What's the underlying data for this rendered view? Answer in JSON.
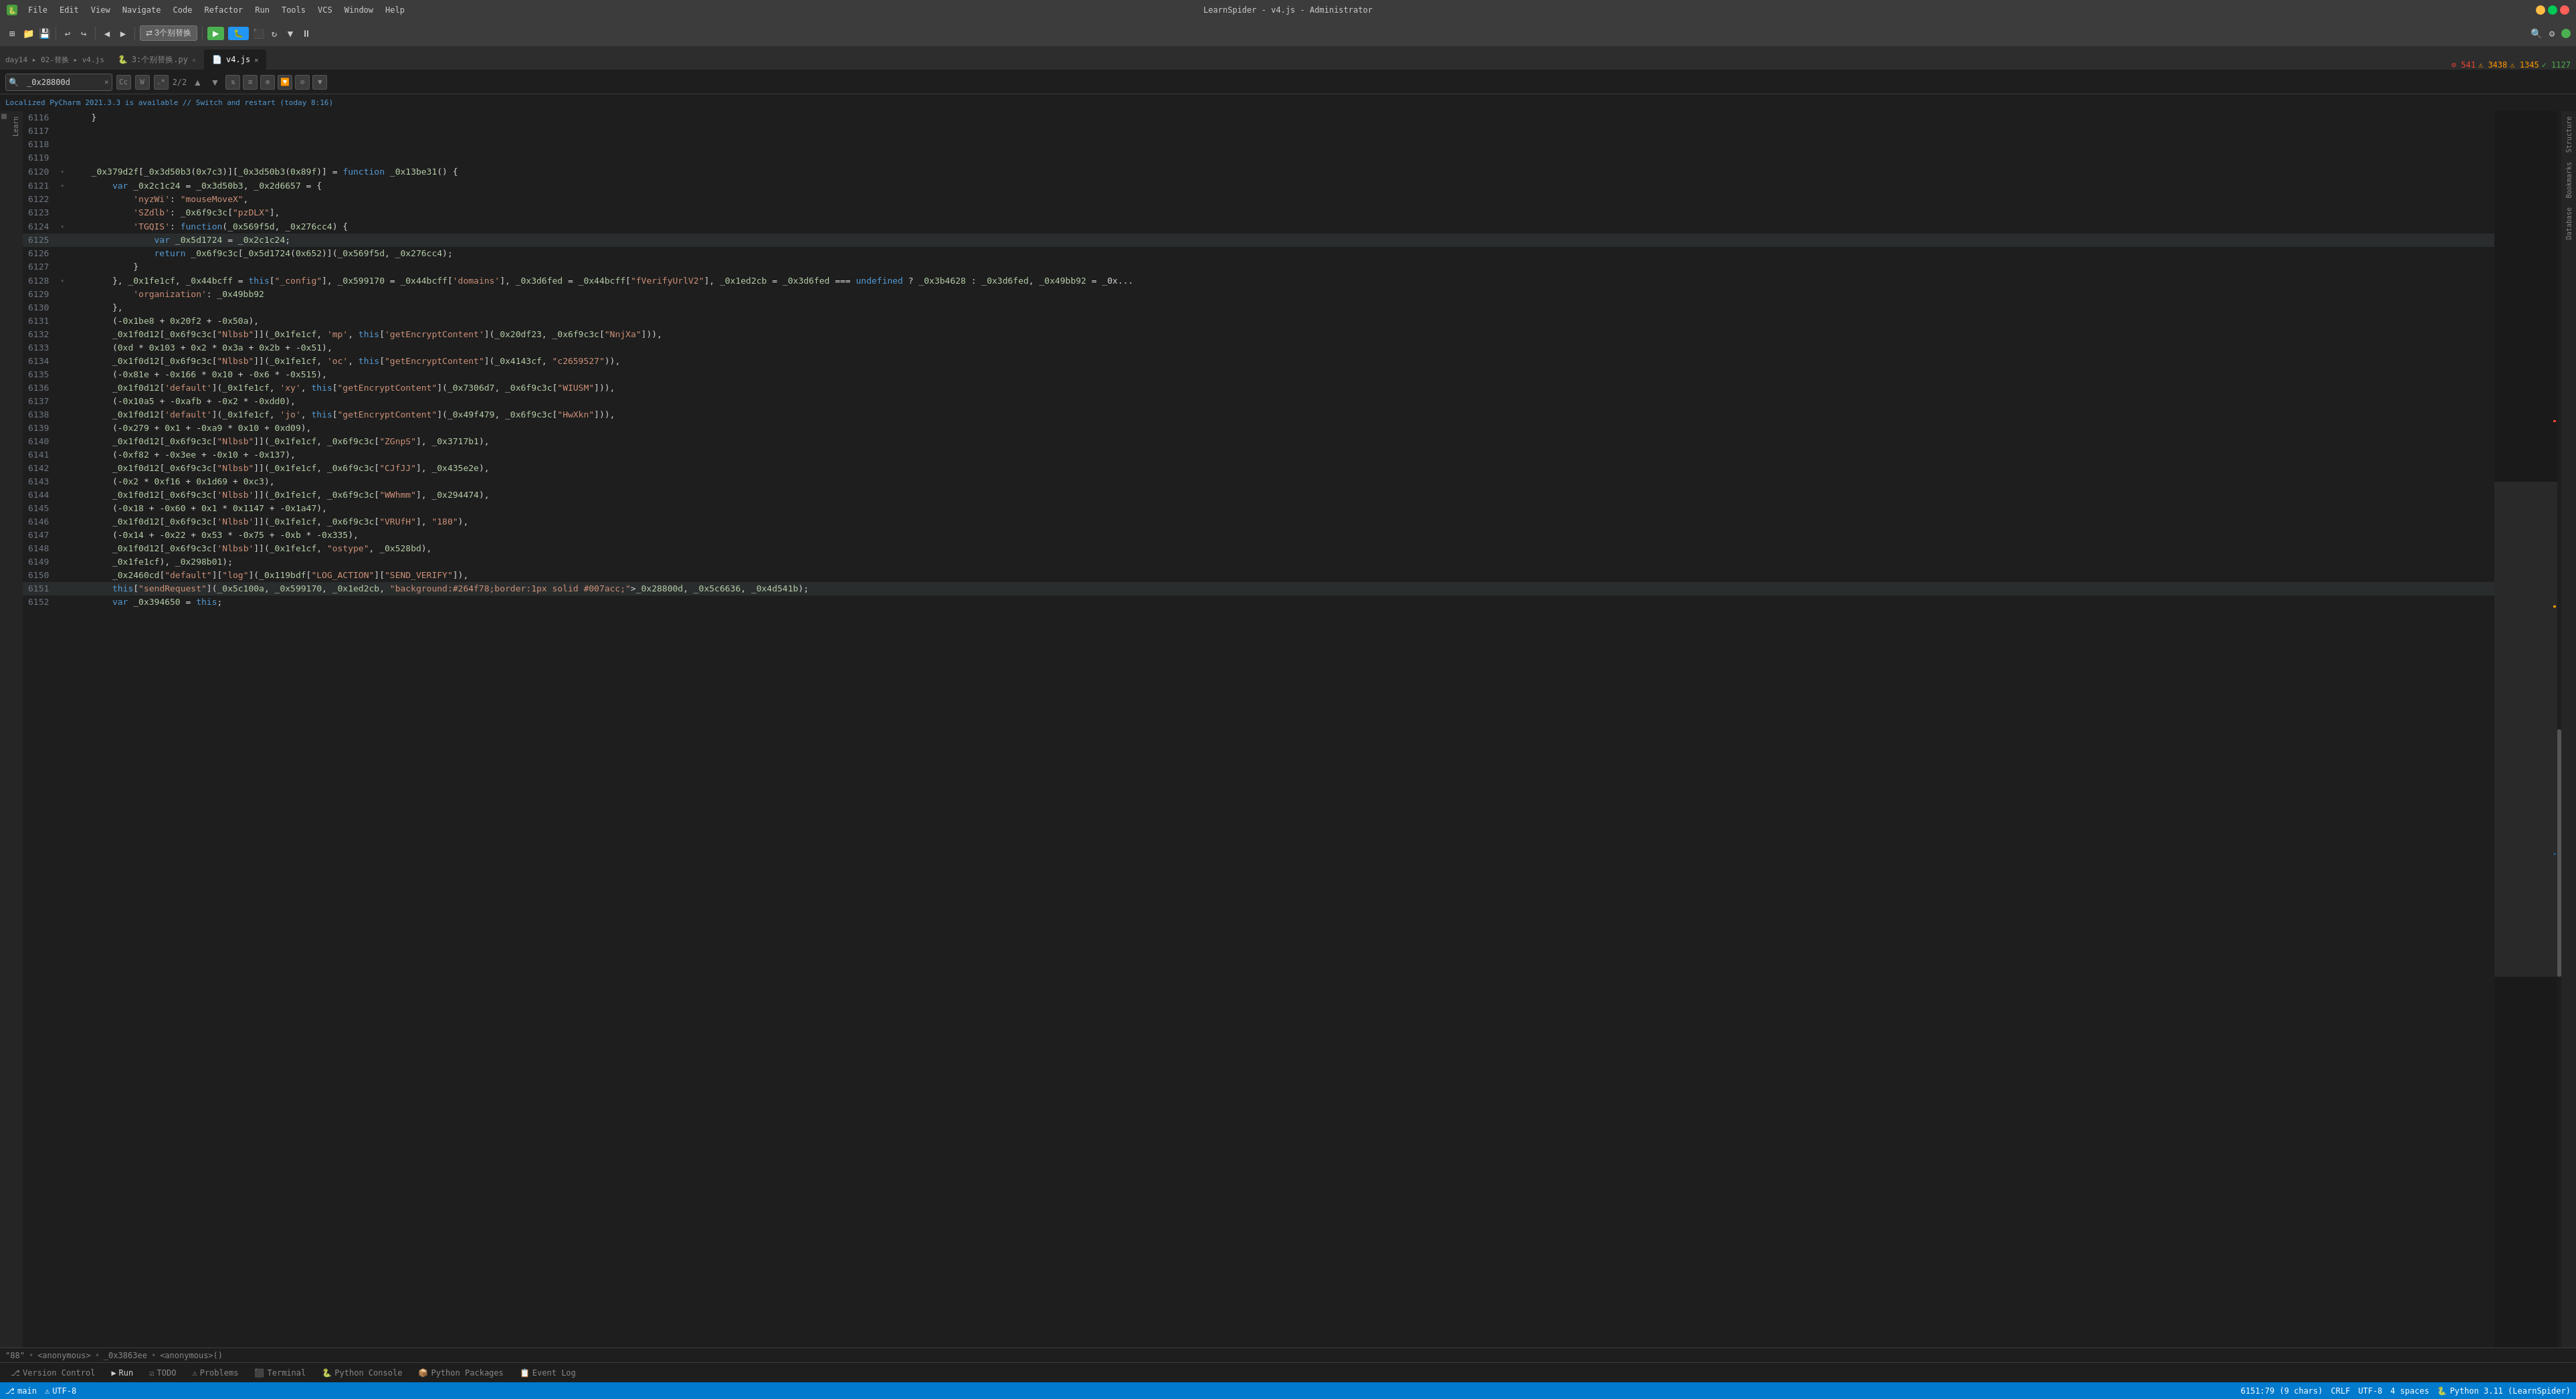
{
  "titleBar": {
    "title": "LearnSpider - v4.js - Administrator",
    "menuItems": [
      "",
      "File",
      "Edit",
      "View",
      "Navigate",
      "Code",
      "Refactor",
      "Run",
      "Tools",
      "VCS",
      "Window",
      "Help"
    ]
  },
  "toolbar": {
    "replaceLabel": "3个别替换",
    "runConfig": "3:个别替换.py"
  },
  "tabs": [
    {
      "label": "3:个别替换.py",
      "active": false,
      "icon": "🐍"
    },
    {
      "label": "v4.js",
      "active": true,
      "icon": "📄"
    }
  ],
  "breadcrumb": {
    "path": "day14 ▸ 02-替换 ▸ v4.js"
  },
  "search": {
    "query": "_0x28800d",
    "count": "2/2",
    "options": [
      "Cc",
      "W",
      ".*"
    ]
  },
  "counters": {
    "errors": "541",
    "warnings": "3438",
    "info": "1345",
    "ok": "1127"
  },
  "codeLines": [
    {
      "num": "6116",
      "indent": "",
      "code": "    }"
    },
    {
      "num": "6117",
      "indent": "",
      "code": ""
    },
    {
      "num": "6118",
      "indent": "",
      "code": ""
    },
    {
      "num": "6119",
      "indent": "",
      "code": ""
    },
    {
      "num": "6120",
      "indent": "",
      "code": "    _0x379d2f[_0x3d50b3(0x7c3)][_0x3d50b3(0x89f)] = function _0x13be31() {"
    },
    {
      "num": "6121",
      "indent": "        ",
      "code": "var _0x2c1c24 = _0x3d50b3, _0x2d6657 = {"
    },
    {
      "num": "6122",
      "indent": "            ",
      "code": "'nyzWi': \"mouseMoveX\","
    },
    {
      "num": "6123",
      "indent": "            ",
      "code": "'SZdlb': _0x6f9c3c[\"pzDLX\"],"
    },
    {
      "num": "6124",
      "indent": "            ",
      "code": "'TGQIS': function(_0x569f5d, _0x276cc4) {"
    },
    {
      "num": "6125",
      "indent": "                ",
      "code": "var _0x5d1724 = _0x2c1c24;"
    },
    {
      "num": "6126",
      "indent": "                ",
      "code": "return _0x6f9c3c[_0x5d1724(0x652)](_0x569f5d, _0x276cc4);"
    },
    {
      "num": "6127",
      "indent": "            ",
      "code": "}"
    },
    {
      "num": "6128",
      "indent": "        ",
      "code": "}, _0x1fe1cf, _0x44bcff = this[\"_config\"], _0x599170 = _0x44bcff['domains'], _0x3d6fed = _0x44bcff[\"fVerifyUrlV2\"], _0x1ed2cb = _0x3d6fed === undefined ? _0x3b4628 : _0x3d6fed, _0x49bb92 = _0x..."
    },
    {
      "num": "6129",
      "indent": "            ",
      "code": "'organization': _0x49bb92"
    },
    {
      "num": "6130",
      "indent": "        ",
      "code": "},"
    },
    {
      "num": "6131",
      "indent": "        ",
      "code": "(-0x1be8 + 0x20f2 + -0x50a),"
    },
    {
      "num": "6132",
      "indent": "        ",
      "code": "_0x1f0d12[_0x6f9c3c[\"Nlbsb\"]](_0x1fe1cf, 'mp', this['getEncryptContent'](_0x20df23, _0x6f9c3c[\"NnjXa\"])),"
    },
    {
      "num": "6133",
      "indent": "        ",
      "code": "(0xd * 0x103 + 0x2 * 0x3a + 0x2b + -0x51),"
    },
    {
      "num": "6134",
      "indent": "        ",
      "code": "_0x1f0d12[_0x6f9c3c[\"Nlbsb\"]](_0x1fe1cf, 'oc', this[\"getEncryptContent\"](_0x4143cf, \"c2659527\")),"
    },
    {
      "num": "6135",
      "indent": "        ",
      "code": "(-0x81e + -0x166 * 0x10 + -0x6 * -0x515),"
    },
    {
      "num": "6136",
      "indent": "        ",
      "code": "_0x1f0d12['default'](_0x1fe1cf, 'xy', this[\"getEncryptContent\"](_0x7306d7, _0x6f9c3c[\"WIUSM\"])),"
    },
    {
      "num": "6137",
      "indent": "        ",
      "code": "(-0x10a5 + -0xafb + -0x2 * -0xdd0),"
    },
    {
      "num": "6138",
      "indent": "        ",
      "code": "_0x1f0d12['default'](_0x1fe1cf, 'jo', this[\"getEncryptContent\"](_0x49f479, _0x6f9c3c[\"HwXkn\"])),"
    },
    {
      "num": "6139",
      "indent": "        ",
      "code": "(-0x279 + 0x1 + -0xa9 * 0x10 + 0xd09),"
    },
    {
      "num": "6140",
      "indent": "        ",
      "code": "_0x1f0d12[_0x6f9c3c[\"Nlbsb\"]](_0x1fe1cf, _0x6f9c3c[\"ZGnpS\"], _0x3717b1),"
    },
    {
      "num": "6141",
      "indent": "        ",
      "code": "(-0xf82 + -0x3ee + -0x10 + -0x137),"
    },
    {
      "num": "6142",
      "indent": "        ",
      "code": "_0x1f0d12[_0x6f9c3c[\"Nlbsb\"]](_0x1fe1cf, _0x6f9c3c[\"CJfJJ\"], _0x435e2e),"
    },
    {
      "num": "6143",
      "indent": "        ",
      "code": "(-0x2 * 0xf16 + 0x1d69 + 0xc3),"
    },
    {
      "num": "6144",
      "indent": "        ",
      "code": "_0x1f0d12[_0x6f9c3c['Nlbsb']](_0x1fe1cf, _0x6f9c3c[\"WWhmm\"], _0x294474),"
    },
    {
      "num": "6145",
      "indent": "        ",
      "code": "(-0x18 + -0x60 + 0x1 * 0x1147 + -0x1a47),"
    },
    {
      "num": "6146",
      "indent": "        ",
      "code": "_0x1f0d12[_0x6f9c3c['Nlbsb']](_0x1fe1cf, _0x6f9c3c[\"VRUfH\"], \"180\"),"
    },
    {
      "num": "6147",
      "indent": "        ",
      "code": "(-0x14 + -0x22 + 0x53 * -0x75 + -0xb * -0x335),"
    },
    {
      "num": "6148",
      "indent": "        ",
      "code": "_0x1f0d12[_0x6f9c3c['Nlbsb']](_0x1fe1cf, \"ostype\", _0x528bd),"
    },
    {
      "num": "6149",
      "indent": "        ",
      "code": "_0x1fe1cf), _0x298b01);"
    },
    {
      "num": "6150",
      "indent": "        ",
      "code": "_0x2460cd[\"default\"][\"log\"](_0x119bdf[\"LOG_ACTION\"][\"SEND_VERIFY\"]),"
    },
    {
      "num": "6151",
      "indent": "        ",
      "code": "this[\"sendRequest\"](_0x5c100a, _0x599170, _0x1ed2cb, _0x28800d, _0x5c6636, _0x4d541b);"
    },
    {
      "num": "6152",
      "indent": "        ",
      "code": "var _0x394650 = this;"
    }
  ],
  "statusBar": {
    "versionControl": "Version Control",
    "run": "Run",
    "todo": "TODO",
    "problems": "Problems",
    "terminal": "Terminal",
    "pythonConsole": "Python Console",
    "pythonPackages": "Python Packages",
    "eventLog": "Event Log",
    "position": "6151:79 (9 chars)",
    "lineEnding": "CRLF",
    "encoding": "UTF-8",
    "indent": "4 spaces",
    "pythonVersion": "Python 3.11 (LearnSpider)",
    "localized": "Localized PyCharm 2021.3.3 is available // Switch and restart (today 8:16)"
  },
  "footer": {
    "lineInfo": "\"88\"",
    "anonymous1": "<anonymous>",
    "hex": "_0x3863ee",
    "anonymous2": "<anonymous>()"
  }
}
